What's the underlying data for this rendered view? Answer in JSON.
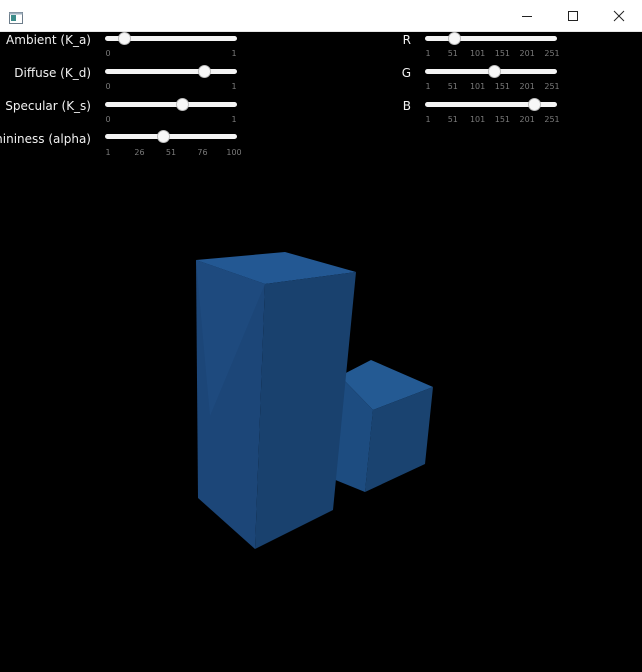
{
  "window": {
    "title": ""
  },
  "material_controls": [
    {
      "label": "Ambient (K_a)",
      "value": 0.12,
      "ticks": [
        "0",
        "1"
      ]
    },
    {
      "label": "Diffuse (K_d)",
      "value": 0.78,
      "ticks": [
        "0",
        "1"
      ]
    },
    {
      "label": "Specular (K_s)",
      "value": 0.6,
      "ticks": [
        "0",
        "1"
      ]
    },
    {
      "label": "Shininess (alpha)",
      "value": 0.44,
      "ticks": [
        "1",
        "26",
        "51",
        "76",
        "100"
      ]
    }
  ],
  "color_controls": [
    {
      "label": "R",
      "value": 0.2,
      "ticks": [
        "1",
        "51",
        "101",
        "151",
        "201",
        "251"
      ]
    },
    {
      "label": "G",
      "value": 0.53,
      "ticks": [
        "1",
        "51",
        "101",
        "151",
        "201",
        "251"
      ]
    },
    {
      "label": "B",
      "value": 0.87,
      "ticks": [
        "1",
        "51",
        "101",
        "151",
        "201",
        "251"
      ]
    }
  ],
  "scene": {
    "object_color": "#1e4f86",
    "background": "#000000"
  }
}
